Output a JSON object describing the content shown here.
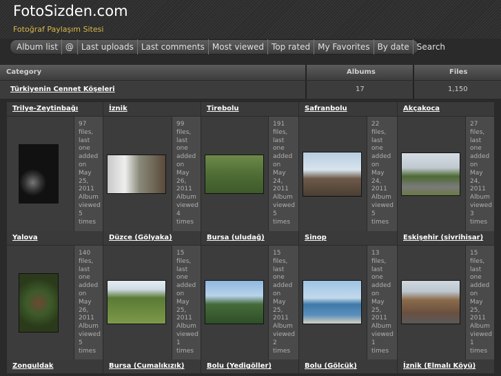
{
  "site": {
    "title": "FotoSizden.com",
    "subtitle": "Fotoğraf Paylaşım Sitesi"
  },
  "nav": [
    "Album list",
    "@",
    "Last uploads",
    "Last comments",
    "Most viewed",
    "Top rated",
    "My Favorites",
    "By date",
    "Search"
  ],
  "table_head": {
    "category": "Category",
    "albums": "Albums",
    "files": "Files"
  },
  "category": {
    "name": "Türkiyenin Cennet Köşeleri",
    "albums": "17",
    "files": "1,150"
  },
  "albums": [
    {
      "title": "Trilye-Zeytinbağı",
      "info": [
        "97",
        "files,",
        "last",
        "one",
        "added",
        "on",
        "May",
        "25,",
        "2011",
        "Album",
        "viewed",
        "5",
        "times"
      ]
    },
    {
      "title": "İznik",
      "info": [
        "99",
        "files,",
        "last",
        "one",
        "added",
        "on",
        "May",
        "26,",
        "2011",
        "Album",
        "viewed",
        "4",
        "times"
      ]
    },
    {
      "title": "Tirebolu",
      "info": [
        "191",
        "files,",
        "last",
        "one",
        "added",
        "on",
        "May",
        "24,",
        "2011",
        "Album",
        "viewed",
        "5",
        "times"
      ]
    },
    {
      "title": "Safranbolu",
      "info": [
        "22",
        "files,",
        "last",
        "one",
        "added",
        "on",
        "May",
        "24,",
        "2011",
        "Album",
        "viewed",
        "5",
        "times"
      ]
    },
    {
      "title": "Akçakoca",
      "info": [
        "27",
        "files,",
        "last",
        "one",
        "added",
        "on",
        "May",
        "24,",
        "2011",
        "Album",
        "viewed",
        "3",
        "times"
      ]
    },
    {
      "title": "Yalova",
      "info": [
        "140",
        "files,",
        "last",
        "one",
        "added",
        "on",
        "May",
        "26,",
        "2011",
        "Album",
        "viewed",
        "5",
        "times"
      ]
    },
    {
      "title": "Düzce (Gölyaka)",
      "info": [
        "15",
        "files,",
        "last",
        "one",
        "added",
        "on",
        "May",
        "25,",
        "2011",
        "Album",
        "viewed",
        "1",
        "times"
      ]
    },
    {
      "title": "Bursa (uludağ)",
      "info": [
        "15",
        "files,",
        "last",
        "one",
        "added",
        "on",
        "May",
        "25,",
        "2011",
        "Album",
        "viewed",
        "2",
        "times"
      ]
    },
    {
      "title": "Sinop",
      "info": [
        "13",
        "files,",
        "last",
        "one",
        "added",
        "on",
        "May",
        "25,",
        "2011",
        "Album",
        "viewed",
        "1",
        "times"
      ]
    },
    {
      "title": "Eskişehir (sivrihisar)",
      "info": [
        "15",
        "files,",
        "last",
        "one",
        "added",
        "on",
        "May",
        "25,",
        "2011",
        "Album",
        "viewed",
        "1",
        "times"
      ]
    },
    {
      "title": "Zonguldak",
      "info": []
    },
    {
      "title": "Bursa (Cumalıkızık)",
      "info": []
    },
    {
      "title": "Bolu (Yedigöller)",
      "info": []
    },
    {
      "title": "Bolu (Gölcük)",
      "info": []
    },
    {
      "title": "İznik (Elmalı Köyü)",
      "info": []
    }
  ]
}
